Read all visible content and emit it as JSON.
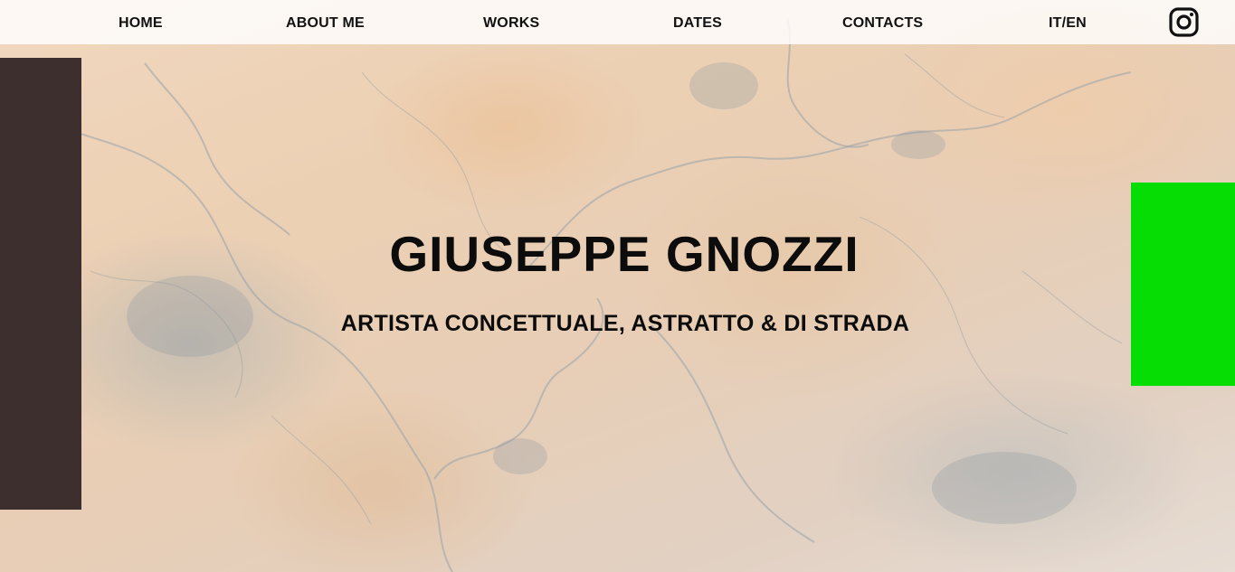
{
  "nav": {
    "items": [
      {
        "label": "HOME"
      },
      {
        "label": "ABOUT ME"
      },
      {
        "label": "WORKS"
      },
      {
        "label": "DATES"
      },
      {
        "label": "CONTACTS"
      },
      {
        "label": "IT/EN"
      }
    ],
    "social_icon": "instagram-icon"
  },
  "hero": {
    "title": "GIUSEPPE GNOZZI",
    "subtitle": "ARTISTA CONCETTUALE, ASTRATTO & DI STRADA",
    "background": "aerial-terrain-map"
  },
  "colors": {
    "left_block": "#3d2f2e",
    "right_block": "#06dd04",
    "text": "#0c0c0c",
    "navbar_bg": "#ffffff"
  }
}
